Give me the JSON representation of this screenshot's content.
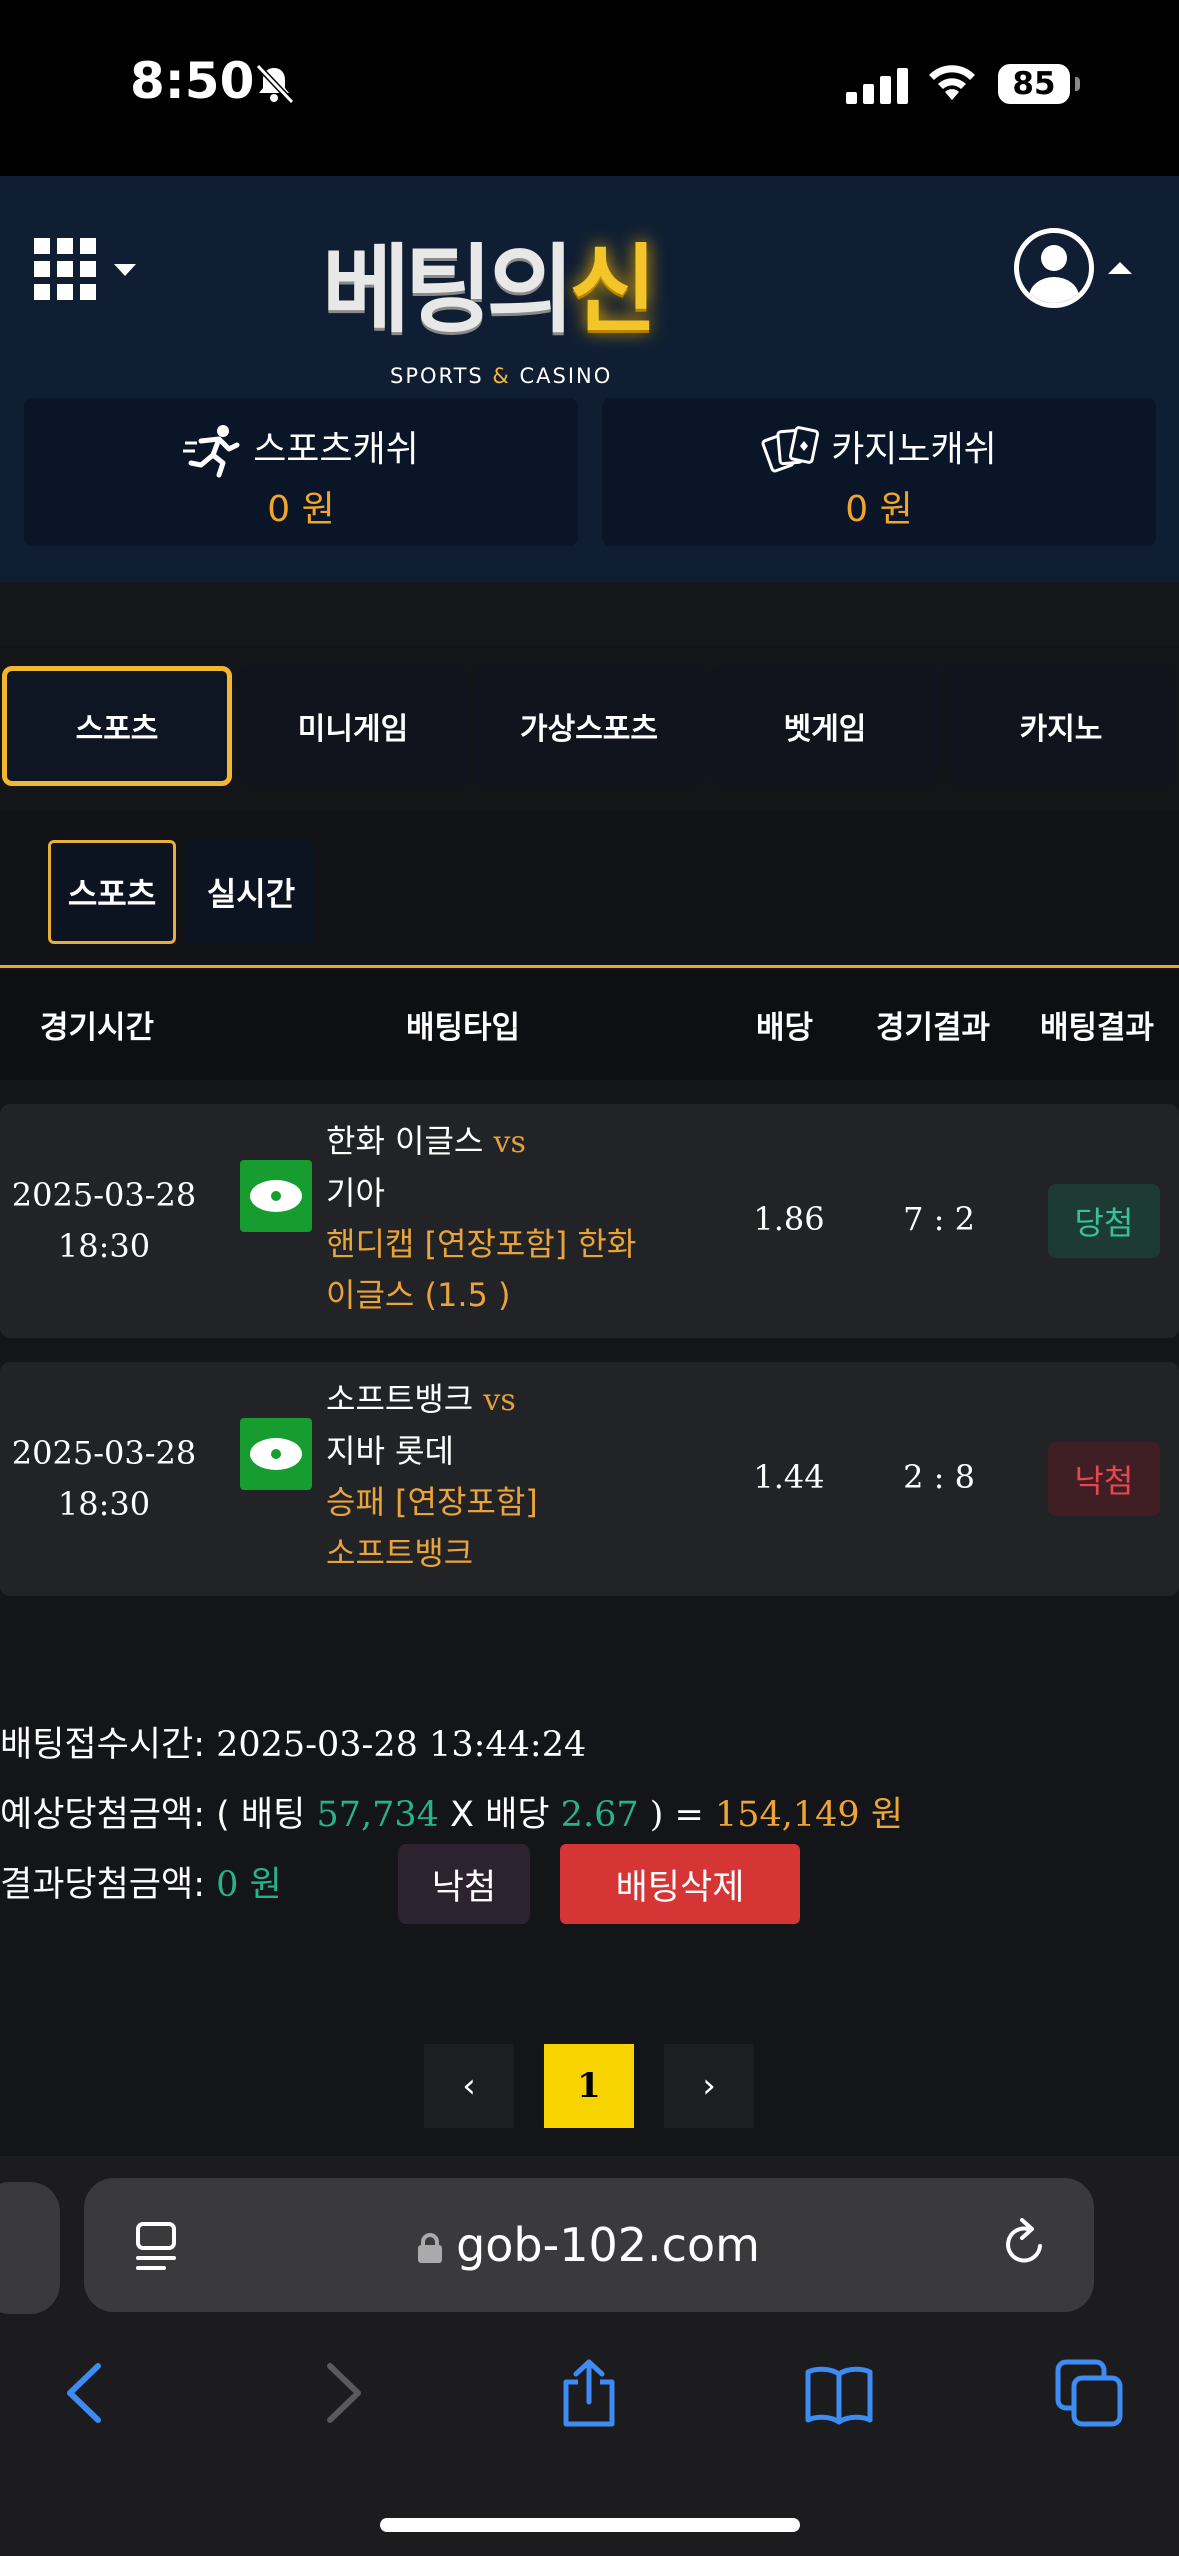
{
  "status_bar": {
    "time": "8:50",
    "battery": "85"
  },
  "header": {
    "logo_main_white": "베팅의",
    "logo_main_gold": "신",
    "logo_sub_left": "SPORTS ",
    "logo_sub_amp": "&",
    "logo_sub_right": " CASINO",
    "sports_cash_label": "스포츠캐쉬",
    "sports_cash_value": "0 원",
    "casino_cash_label": "카지노캐쉬",
    "casino_cash_value": "0 원"
  },
  "main_tabs": [
    "스포츠",
    "미니게임",
    "가상스포츠",
    "벳게임",
    "카지노"
  ],
  "sub_tabs": [
    "스포츠",
    "실시간"
  ],
  "table_headers": [
    "경기시간",
    "배팅타입",
    "배당",
    "경기결과",
    "배팅결과"
  ],
  "bets": [
    {
      "date": "2025-03-28",
      "time": "18:30",
      "home": "한화 이글스",
      "vs": "vs",
      "away": "기아",
      "pick_line1": "핸디캡 [연장포함] 한화",
      "pick_line2": "이글스 (1.5 )",
      "odds": "1.86",
      "score": "7 : 2",
      "result": "당첨"
    },
    {
      "date": "2025-03-28",
      "time": "18:30",
      "home": "소프트뱅크",
      "vs": "vs",
      "away": "지바 롯데",
      "pick_line1": "승패 [연장포함]",
      "pick_line2": "소프트뱅크",
      "odds": "1.44",
      "score": "2 : 8",
      "result": "낙첨"
    }
  ],
  "summary": {
    "received_label": "배팅접수시간: ",
    "received_value": "2025-03-28 13:44:24",
    "expected_label": "예상당첨금액: ",
    "expected_open": "( 배팅 ",
    "expected_stake": "57,734",
    "expected_x": " X 배당 ",
    "expected_odds": "2.67",
    "expected_close": " ) = ",
    "expected_total": "154,149 원",
    "result_label": "결과당첨금액: ",
    "result_value": "0 원",
    "lose_button": "낙첨",
    "delete_button": "배팅삭제"
  },
  "pagination": {
    "prev": "‹",
    "current": "1",
    "next": "›"
  },
  "browser": {
    "url": "gob-102.com"
  },
  "colors": {
    "accent_gold": "#f4b62f",
    "win_green": "#35c29b",
    "lose_red": "#e5464f",
    "delete_red": "#d63535",
    "page_yellow": "#f7d400"
  }
}
